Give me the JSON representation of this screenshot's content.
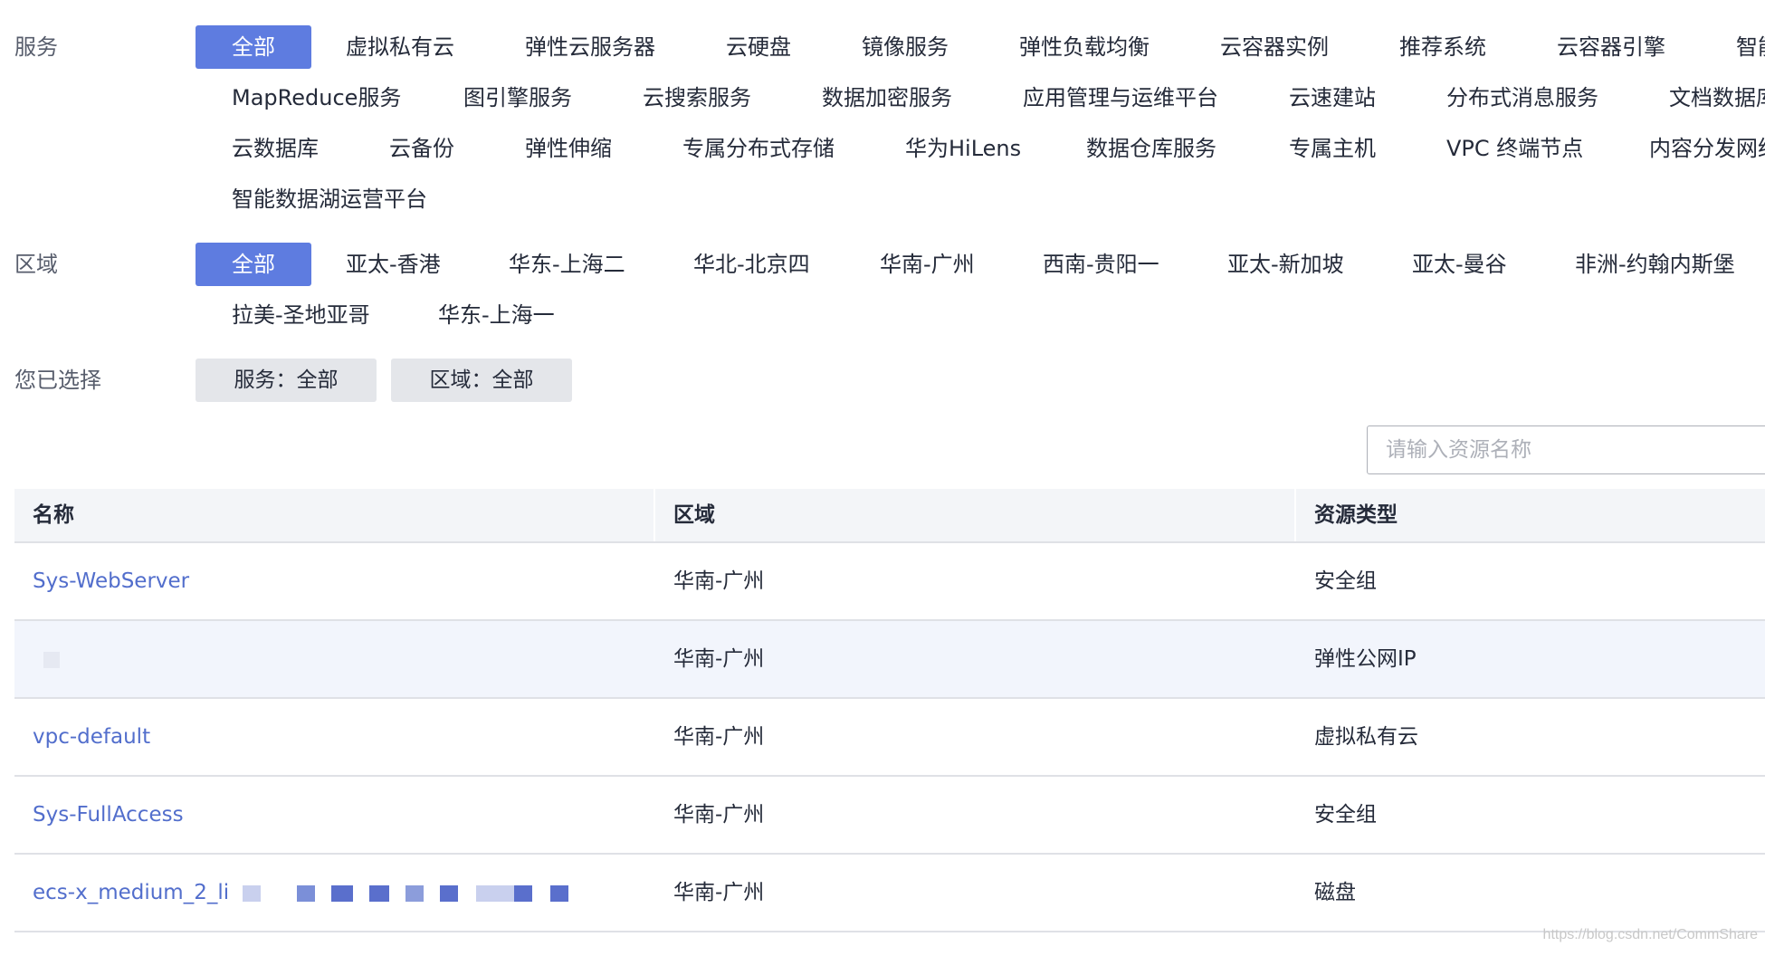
{
  "service_filter": {
    "label": "服务",
    "rows": [
      [
        "全部",
        "虚拟私有云",
        "弹性云服务器",
        "云硬盘",
        "镜像服务",
        "弹性负载均衡",
        "云容器实例",
        "推荐系统",
        "云容器引擎",
        "智能"
      ],
      [
        "MapReduce服务",
        "图引擎服务",
        "云搜索服务",
        "数据加密服务",
        "应用管理与运维平台",
        "云速建站",
        "分布式消息服务",
        "文档数据库"
      ],
      [
        "云数据库",
        "云备份",
        "弹性伸缩",
        "专属分布式存储",
        "华为HiLens",
        "数据仓库服务",
        "专属主机",
        "VPC 终端节点",
        "内容分发网络"
      ],
      [
        "智能数据湖运营平台"
      ]
    ]
  },
  "region_filter": {
    "label": "区域",
    "rows": [
      [
        "全部",
        "亚太-香港",
        "华东-上海二",
        "华北-北京四",
        "华南-广州",
        "西南-贵阳一",
        "亚太-新加坡",
        "亚太-曼谷",
        "非洲-约翰内斯堡"
      ],
      [
        "拉美-圣地亚哥",
        "华东-上海一"
      ]
    ]
  },
  "selected": {
    "label": "您已选择",
    "tags": [
      "服务：全部",
      "区域：全部"
    ]
  },
  "search": {
    "placeholder": "请输入资源名称"
  },
  "table": {
    "headers": [
      "名称",
      "区域",
      "资源类型"
    ],
    "rows": [
      {
        "name": "Sys-WebServer",
        "region": "华南-广州",
        "type": "安全组"
      },
      {
        "name": "",
        "region": "华南-广州",
        "type": "弹性公网IP"
      },
      {
        "name": "vpc-default",
        "region": "华南-广州",
        "type": "虚拟私有云"
      },
      {
        "name": "Sys-FullAccess",
        "region": "华南-广州",
        "type": "安全组"
      },
      {
        "name": "ecs-x_medium_2_li",
        "region": "华南-广州",
        "type": "磁盘"
      }
    ]
  },
  "watermark": "https://blog.csdn.net/CommShare",
  "colors": {
    "accent": "#5e7ce0",
    "link": "#526ecc",
    "header_bg": "#f3f5f8",
    "alt_row_bg": "#f2f5fc",
    "tag_bg": "#e4e6ea"
  }
}
